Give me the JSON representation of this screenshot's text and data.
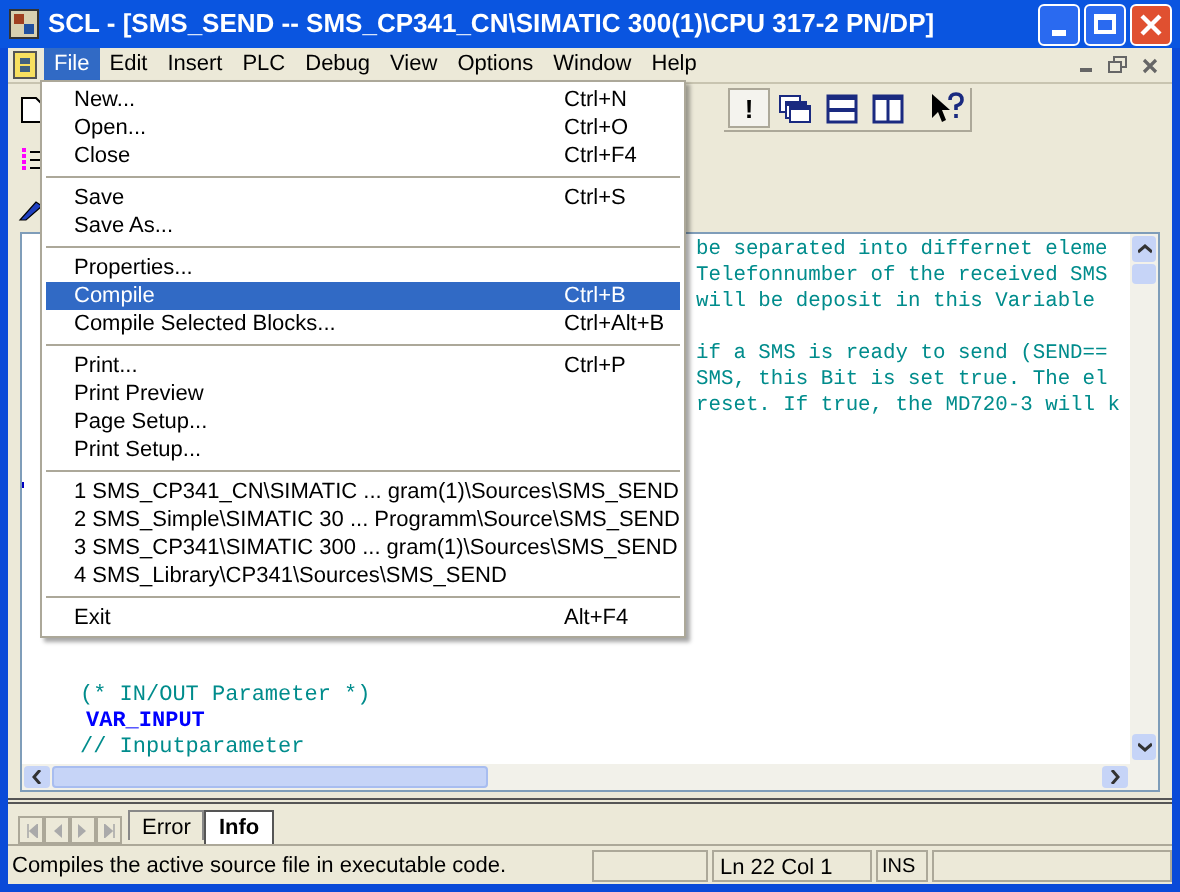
{
  "window": {
    "title": "SCL  - [SMS_SEND -- SMS_CP341_CN\\SIMATIC 300(1)\\CPU 317-2 PN/DP]"
  },
  "menubar": [
    {
      "label": "File",
      "selected": true
    },
    {
      "label": "Edit",
      "selected": false
    },
    {
      "label": "Insert",
      "selected": false
    },
    {
      "label": "PLC",
      "selected": false
    },
    {
      "label": "Debug",
      "selected": false
    },
    {
      "label": "View",
      "selected": false
    },
    {
      "label": "Options",
      "selected": false
    },
    {
      "label": "Window",
      "selected": false
    },
    {
      "label": "Help",
      "selected": false
    }
  ],
  "file_menu": [
    {
      "kind": "item",
      "label": "New...",
      "shortcut": "Ctrl+N",
      "selected": false
    },
    {
      "kind": "item",
      "label": "Open...",
      "shortcut": "Ctrl+O",
      "selected": false
    },
    {
      "kind": "item",
      "label": "Close",
      "shortcut": "Ctrl+F4",
      "selected": false
    },
    {
      "kind": "separator"
    },
    {
      "kind": "item",
      "label": "Save",
      "shortcut": "Ctrl+S",
      "selected": false
    },
    {
      "kind": "item",
      "label": "Save As...",
      "selected": false
    },
    {
      "kind": "separator"
    },
    {
      "kind": "item",
      "label": "Properties...",
      "selected": false
    },
    {
      "kind": "item",
      "label": "Compile",
      "shortcut": "Ctrl+B",
      "selected": true
    },
    {
      "kind": "item",
      "label": "Compile Selected Blocks...",
      "shortcut": "Ctrl+Alt+B",
      "selected": false
    },
    {
      "kind": "separator"
    },
    {
      "kind": "item",
      "label": "Print...",
      "shortcut": "Ctrl+P",
      "selected": false
    },
    {
      "kind": "item",
      "label": "Print Preview",
      "selected": false
    },
    {
      "kind": "item",
      "label": "Page Setup...",
      "selected": false
    },
    {
      "kind": "item",
      "label": "Print Setup...",
      "selected": false
    },
    {
      "kind": "separator"
    },
    {
      "kind": "item",
      "label": "1 SMS_CP341_CN\\SIMATIC  ... gram(1)\\Sources\\SMS_SEND",
      "selected": false
    },
    {
      "kind": "item",
      "label": "2 SMS_Simple\\SIMATIC 30 ... Programm\\Source\\SMS_SEND",
      "selected": false
    },
    {
      "kind": "item",
      "label": "3 SMS_CP341\\SIMATIC 300 ... gram(1)\\Sources\\SMS_SEND",
      "selected": false
    },
    {
      "kind": "item",
      "label": "4 SMS_Library\\CP341\\Sources\\SMS_SEND",
      "selected": false
    },
    {
      "kind": "separator"
    },
    {
      "kind": "item",
      "label": "Exit",
      "shortcut": "Alt+F4",
      "selected": false
    }
  ],
  "toolbar": {
    "toggle_label": "!"
  },
  "editor": {
    "fragment_blocks": [
      {
        "lines": [
          "be separated into differnet eleme",
          "Telefonnumber of the received SMS",
          "will be deposit in this Variable"
        ]
      },
      {
        "lines": [
          "if a SMS is ready to send (SEND==",
          "SMS, this Bit is set true. The el",
          "reset. If true, the MD720-3 will k"
        ]
      }
    ],
    "lines": [
      {
        "kind": "comment",
        "text": "(* IN/OUT Parameter *)"
      },
      {
        "kind": "keyword",
        "text": "VAR_INPUT"
      },
      {
        "kind": "comment",
        "text": "// Inputparameter"
      }
    ]
  },
  "bottom_tabs": [
    {
      "label": "Error",
      "selected": false
    },
    {
      "label": "Info",
      "selected": true
    }
  ],
  "status_bar": {
    "message": "Compiles the active source file in executable code.",
    "position": "Ln 22 Col 1",
    "mode": "INS"
  }
}
